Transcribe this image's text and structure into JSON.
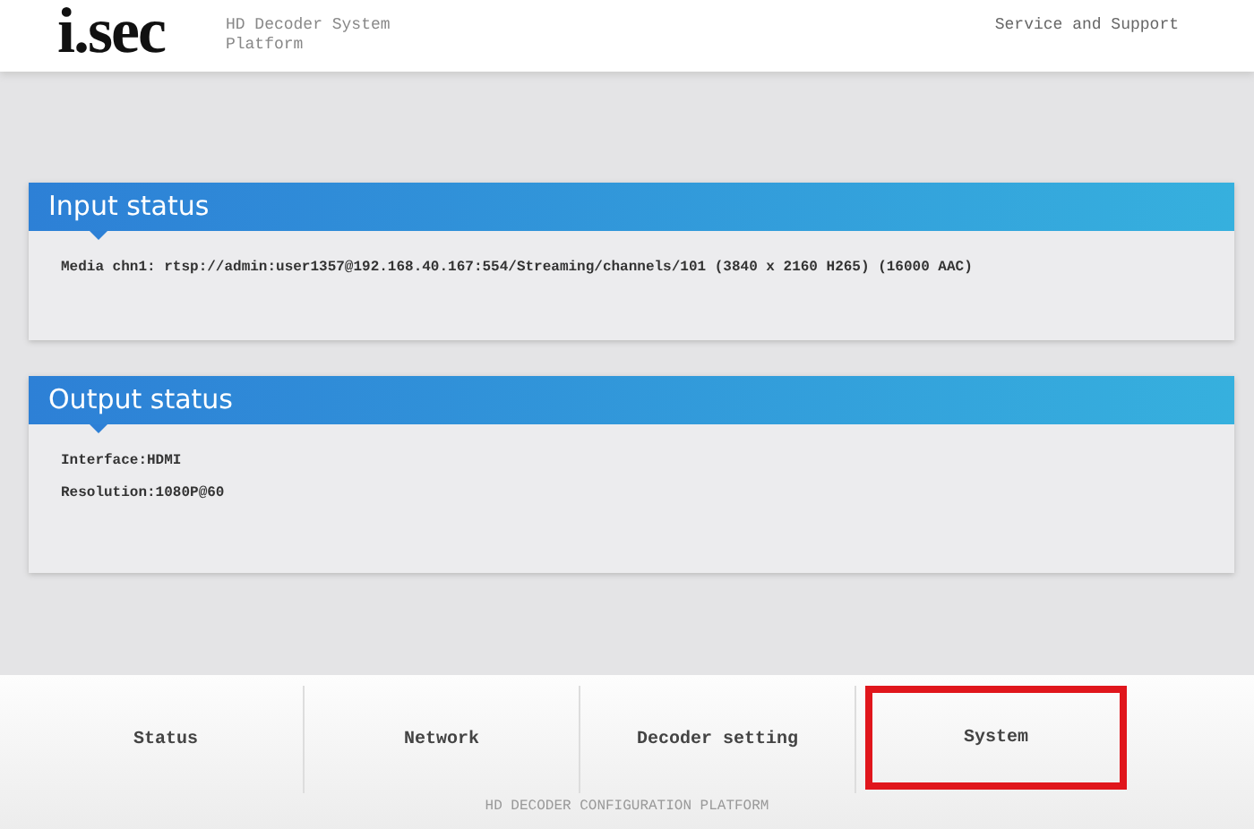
{
  "header": {
    "logo": "i.sec",
    "subtitle": "HD Decoder System Platform",
    "link": "Service and Support"
  },
  "panels": [
    {
      "title": "Input status",
      "lines": [
        "Media chn1: rtsp://admin:user1357@192.168.40.167:554/Streaming/channels/101 (3840 x 2160 H265) (16000 AAC)"
      ]
    },
    {
      "title": "Output status",
      "lines": [
        "Interface:HDMI",
        "Resolution:1080P@60"
      ]
    }
  ],
  "nav": [
    {
      "label": "Status",
      "highlighted": false
    },
    {
      "label": "Network",
      "highlighted": false
    },
    {
      "label": "Decoder setting",
      "highlighted": false
    },
    {
      "label": "System",
      "highlighted": true
    }
  ],
  "footer": "HD DECODER CONFIGURATION PLATFORM"
}
